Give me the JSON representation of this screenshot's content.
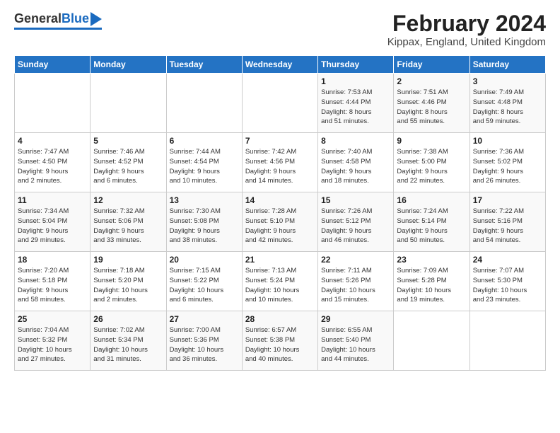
{
  "header": {
    "logo_general": "General",
    "logo_blue": "Blue",
    "title": "February 2024",
    "subtitle": "Kippax, England, United Kingdom"
  },
  "days_of_week": [
    "Sunday",
    "Monday",
    "Tuesday",
    "Wednesday",
    "Thursday",
    "Friday",
    "Saturday"
  ],
  "weeks": [
    [
      {
        "day": "",
        "info": ""
      },
      {
        "day": "",
        "info": ""
      },
      {
        "day": "",
        "info": ""
      },
      {
        "day": "",
        "info": ""
      },
      {
        "day": "1",
        "info": "Sunrise: 7:53 AM\nSunset: 4:44 PM\nDaylight: 8 hours\nand 51 minutes."
      },
      {
        "day": "2",
        "info": "Sunrise: 7:51 AM\nSunset: 4:46 PM\nDaylight: 8 hours\nand 55 minutes."
      },
      {
        "day": "3",
        "info": "Sunrise: 7:49 AM\nSunset: 4:48 PM\nDaylight: 8 hours\nand 59 minutes."
      }
    ],
    [
      {
        "day": "4",
        "info": "Sunrise: 7:47 AM\nSunset: 4:50 PM\nDaylight: 9 hours\nand 2 minutes."
      },
      {
        "day": "5",
        "info": "Sunrise: 7:46 AM\nSunset: 4:52 PM\nDaylight: 9 hours\nand 6 minutes."
      },
      {
        "day": "6",
        "info": "Sunrise: 7:44 AM\nSunset: 4:54 PM\nDaylight: 9 hours\nand 10 minutes."
      },
      {
        "day": "7",
        "info": "Sunrise: 7:42 AM\nSunset: 4:56 PM\nDaylight: 9 hours\nand 14 minutes."
      },
      {
        "day": "8",
        "info": "Sunrise: 7:40 AM\nSunset: 4:58 PM\nDaylight: 9 hours\nand 18 minutes."
      },
      {
        "day": "9",
        "info": "Sunrise: 7:38 AM\nSunset: 5:00 PM\nDaylight: 9 hours\nand 22 minutes."
      },
      {
        "day": "10",
        "info": "Sunrise: 7:36 AM\nSunset: 5:02 PM\nDaylight: 9 hours\nand 26 minutes."
      }
    ],
    [
      {
        "day": "11",
        "info": "Sunrise: 7:34 AM\nSunset: 5:04 PM\nDaylight: 9 hours\nand 29 minutes."
      },
      {
        "day": "12",
        "info": "Sunrise: 7:32 AM\nSunset: 5:06 PM\nDaylight: 9 hours\nand 33 minutes."
      },
      {
        "day": "13",
        "info": "Sunrise: 7:30 AM\nSunset: 5:08 PM\nDaylight: 9 hours\nand 38 minutes."
      },
      {
        "day": "14",
        "info": "Sunrise: 7:28 AM\nSunset: 5:10 PM\nDaylight: 9 hours\nand 42 minutes."
      },
      {
        "day": "15",
        "info": "Sunrise: 7:26 AM\nSunset: 5:12 PM\nDaylight: 9 hours\nand 46 minutes."
      },
      {
        "day": "16",
        "info": "Sunrise: 7:24 AM\nSunset: 5:14 PM\nDaylight: 9 hours\nand 50 minutes."
      },
      {
        "day": "17",
        "info": "Sunrise: 7:22 AM\nSunset: 5:16 PM\nDaylight: 9 hours\nand 54 minutes."
      }
    ],
    [
      {
        "day": "18",
        "info": "Sunrise: 7:20 AM\nSunset: 5:18 PM\nDaylight: 9 hours\nand 58 minutes."
      },
      {
        "day": "19",
        "info": "Sunrise: 7:18 AM\nSunset: 5:20 PM\nDaylight: 10 hours\nand 2 minutes."
      },
      {
        "day": "20",
        "info": "Sunrise: 7:15 AM\nSunset: 5:22 PM\nDaylight: 10 hours\nand 6 minutes."
      },
      {
        "day": "21",
        "info": "Sunrise: 7:13 AM\nSunset: 5:24 PM\nDaylight: 10 hours\nand 10 minutes."
      },
      {
        "day": "22",
        "info": "Sunrise: 7:11 AM\nSunset: 5:26 PM\nDaylight: 10 hours\nand 15 minutes."
      },
      {
        "day": "23",
        "info": "Sunrise: 7:09 AM\nSunset: 5:28 PM\nDaylight: 10 hours\nand 19 minutes."
      },
      {
        "day": "24",
        "info": "Sunrise: 7:07 AM\nSunset: 5:30 PM\nDaylight: 10 hours\nand 23 minutes."
      }
    ],
    [
      {
        "day": "25",
        "info": "Sunrise: 7:04 AM\nSunset: 5:32 PM\nDaylight: 10 hours\nand 27 minutes."
      },
      {
        "day": "26",
        "info": "Sunrise: 7:02 AM\nSunset: 5:34 PM\nDaylight: 10 hours\nand 31 minutes."
      },
      {
        "day": "27",
        "info": "Sunrise: 7:00 AM\nSunset: 5:36 PM\nDaylight: 10 hours\nand 36 minutes."
      },
      {
        "day": "28",
        "info": "Sunrise: 6:57 AM\nSunset: 5:38 PM\nDaylight: 10 hours\nand 40 minutes."
      },
      {
        "day": "29",
        "info": "Sunrise: 6:55 AM\nSunset: 5:40 PM\nDaylight: 10 hours\nand 44 minutes."
      },
      {
        "day": "",
        "info": ""
      },
      {
        "day": "",
        "info": ""
      }
    ]
  ]
}
